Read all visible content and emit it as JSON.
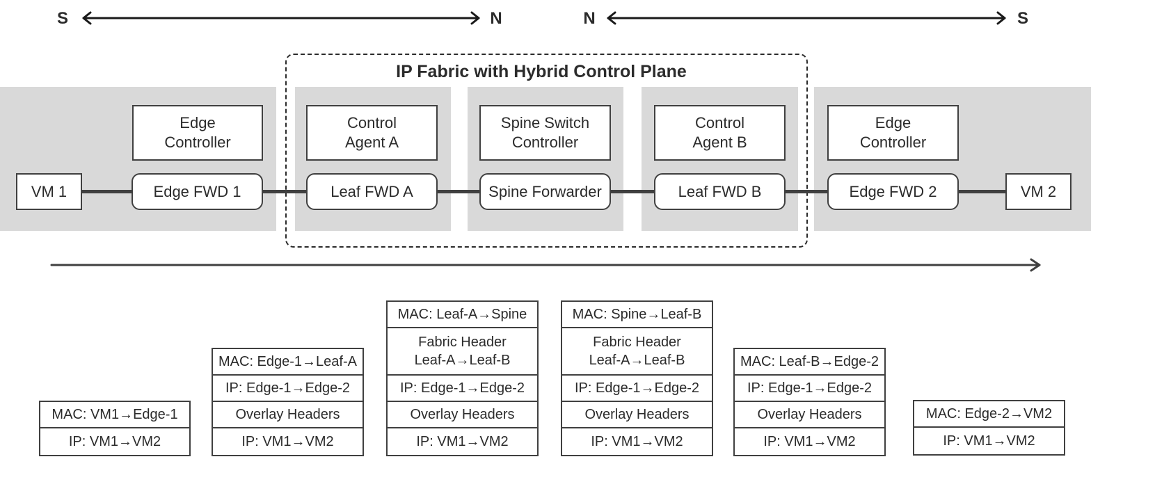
{
  "direction_indicators": {
    "left": {
      "start": "S",
      "end": "N"
    },
    "right": {
      "start": "N",
      "end": "S"
    }
  },
  "fabric": {
    "title": "IP Fabric with Hybrid Control Plane"
  },
  "nodes": {
    "vm1": "VM 1",
    "vm2": "VM 2",
    "edge_controller_1": "Edge\nController",
    "edge_controller_2": "Edge\nController",
    "control_agent_a": "Control\nAgent A",
    "spine_controller": "Spine Switch\nController",
    "control_agent_b": "Control\nAgent B",
    "edge_fwd_1": "Edge FWD 1",
    "leaf_fwd_a": "Leaf FWD A",
    "spine_forwarder": "Spine Forwarder",
    "leaf_fwd_b": "Leaf FWD B",
    "edge_fwd_2": "Edge FWD 2"
  },
  "packet_stacks": [
    {
      "hop": "VM1 to Edge-1",
      "layers": [
        "MAC: VM1→Edge-1",
        "IP: VM1→VM2"
      ]
    },
    {
      "hop": "Edge-1 to Leaf-A",
      "layers": [
        "MAC: Edge-1→Leaf-A",
        "IP: Edge-1→Edge-2",
        "Overlay Headers",
        "IP: VM1→VM2"
      ]
    },
    {
      "hop": "Leaf-A to Spine",
      "layers": [
        "MAC: Leaf-A→Spine",
        "Fabric Header\nLeaf-A→Leaf-B",
        "IP: Edge-1→Edge-2",
        "Overlay Headers",
        "IP: VM1→VM2"
      ]
    },
    {
      "hop": "Spine to Leaf-B",
      "layers": [
        "MAC: Spine→Leaf-B",
        "Fabric Header\nLeaf-A→Leaf-B",
        "IP: Edge-1→Edge-2",
        "Overlay Headers",
        "IP: VM1→VM2"
      ]
    },
    {
      "hop": "Leaf-B to Edge-2",
      "layers": [
        "MAC: Leaf-B→Edge-2",
        "IP: Edge-1→Edge-2",
        "Overlay Headers",
        "IP: VM1→VM2"
      ]
    },
    {
      "hop": "Edge-2 to VM2",
      "layers": [
        "MAC: Edge-2→VM2",
        "IP: VM1→VM2"
      ]
    }
  ],
  "colors": {
    "region_fill": "#d9d9d9",
    "stroke": "#404040",
    "text": "#2b2b2b"
  }
}
